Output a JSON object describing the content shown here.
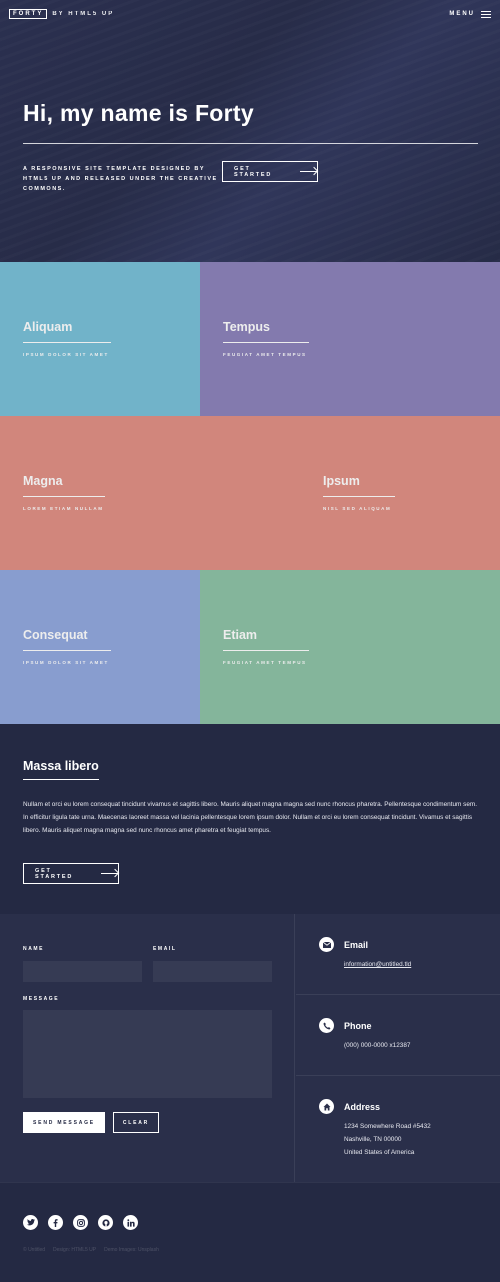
{
  "header": {
    "logo": "FORTY",
    "byline": "BY HTML5 UP",
    "menu_label": "MENU"
  },
  "banner": {
    "title": "Hi, my name is Forty",
    "subtitle": "A responsive site template designed by HTML5 UP and released under the Creative Commons.",
    "button_label": "GET STARTED"
  },
  "tiles": [
    {
      "title": "Aliquam",
      "subtitle": "Ipsum dolor sit amet",
      "color": "#6fc3df"
    },
    {
      "title": "Tempus",
      "subtitle": "Feugiat amet tempus",
      "color": "#8d82c4"
    },
    {
      "title": "Magna",
      "subtitle": "Lorem etiam nullam",
      "color": "#ec8d81"
    },
    {
      "title": "Ipsum",
      "subtitle": "Nisl sed aliquam",
      "color": "#ec8d81"
    },
    {
      "title": "Consequat",
      "subtitle": "Ipsum dolor sit amet",
      "color": "#8ea9e8"
    },
    {
      "title": "Etiam",
      "subtitle": "Feugiat amet tempus",
      "color": "#87c5a4"
    }
  ],
  "intro": {
    "title": "Massa libero",
    "text": "Nullam et orci eu lorem consequat tincidunt vivamus et sagittis libero. Mauris aliquet magna magna sed nunc rhoncus pharetra. Pellentesque condimentum sem. In efficitur ligula tate urna. Maecenas laoreet massa vel lacinia pellentesque lorem ipsum dolor. Nullam et orci eu lorem consequat tincidunt. Vivamus et sagittis libero. Mauris aliquet magna magna sed nunc rhoncus amet pharetra et feugiat tempus.",
    "button_label": "GET STARTED"
  },
  "form": {
    "name_label": "NAME",
    "email_label": "EMAIL",
    "message_label": "MESSAGE",
    "send_label": "SEND MESSAGE",
    "clear_label": "CLEAR"
  },
  "contact": {
    "email_title": "Email",
    "email_value": "information@untitled.tld",
    "phone_title": "Phone",
    "phone_value": "(000) 000-0000 x12387",
    "address_title": "Address",
    "address_line1": "1234 Somewhere Road #5432",
    "address_line2": "Nashville, TN 00000",
    "address_line3": "United States of America"
  },
  "footer": {
    "social": [
      "twitter-icon",
      "facebook-icon",
      "instagram-icon",
      "github-icon",
      "linkedin-icon"
    ],
    "copyright": [
      "© Untitled",
      "Design: HTML5 UP",
      "Demo Images: Unsplash"
    ]
  },
  "colors": {
    "background": "#242943",
    "panel": "#2a2f4a",
    "accent_cyan": "#6fc3df",
    "accent_purple": "#8d82c4",
    "accent_salmon": "#ec8d81",
    "accent_blue": "#8ea9e8",
    "accent_green": "#87c5a4"
  }
}
